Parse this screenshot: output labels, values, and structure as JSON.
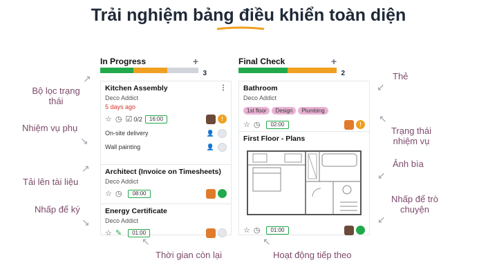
{
  "headline": {
    "before": "Trải nghiệm bảng ",
    "highlight": "điều",
    "after": " khiển toàn diện"
  },
  "annotations": {
    "filter": "Bộ lọc trạng\nthái",
    "subtask": "Nhiệm vụ phụ",
    "upload": "Tải lên tài liệu",
    "sign": "Nhấp để ký",
    "time_left": "Thời gian còn lại",
    "next_activity": "Hoạt động tiếp theo",
    "tag": "Thẻ",
    "task_status": "Trạng thái\nnhiệm vụ",
    "cover": "Ảnh bìa",
    "chat": "Nhấp để trò\nchuyện"
  },
  "columns": [
    {
      "title": "In Progress",
      "count": "3",
      "plus": "+",
      "progress": [
        0.34,
        0.34
      ]
    },
    {
      "title": "Final Check",
      "count": "2",
      "plus": "+",
      "progress": [
        0.5,
        0.5
      ]
    }
  ],
  "cards": {
    "kitchen": {
      "title": "Kitchen Assembly",
      "customer": "Deco Addict",
      "deadline": "5 days ago",
      "subtasks": "0/2",
      "time": "16:00",
      "status": "!",
      "menu": "⋮",
      "subtask_items": [
        "On-site delivery",
        "Wall painting"
      ]
    },
    "architect": {
      "title": "Architect (Invoice on Timesheets)",
      "customer": "Deco Addict",
      "time": "08:00"
    },
    "energy": {
      "title": "Energy Certificate",
      "customer": "Deco Addict",
      "time": "01:00"
    },
    "bathroom": {
      "title": "Bathroom",
      "customer": "Deco Addict",
      "tags": [
        "1st floor",
        "Design",
        "Plumbing"
      ],
      "time": "02:00",
      "status": "!"
    },
    "floor": {
      "title": "First Floor - Plans",
      "time": "01:00"
    }
  },
  "icons": {
    "star": "☆",
    "clock": "◷",
    "check": "☑",
    "sign": "✎",
    "assign": "👤"
  },
  "colors": {
    "green": "#22a94b",
    "orange": "#f0a020",
    "tag": "#e9b2d3",
    "annotation": "#7c4a6b"
  }
}
